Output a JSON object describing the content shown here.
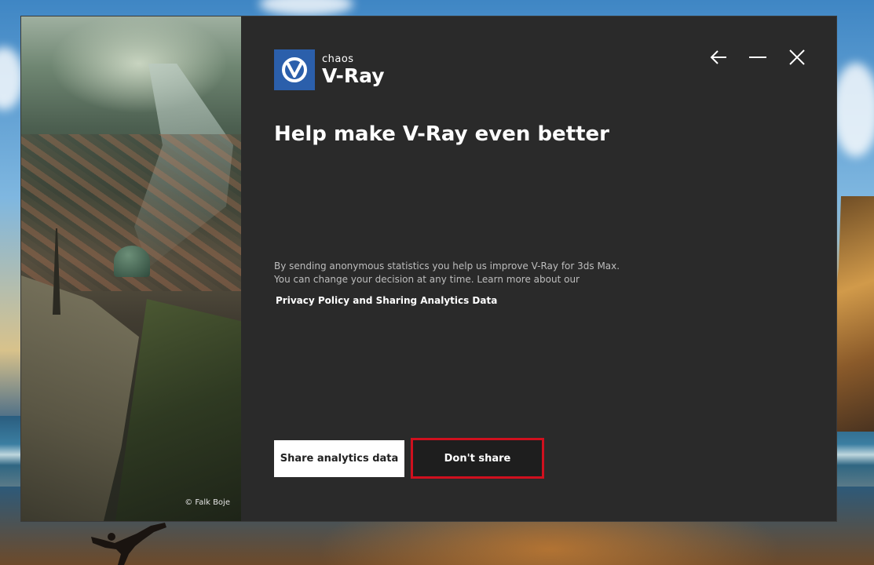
{
  "app": {
    "brand_company": "chaos",
    "brand_product": "V-Ray",
    "accent_color": "#2b5fab",
    "highlight_color": "#d0101e"
  },
  "window_controls": {
    "back_icon": "arrow-left-icon",
    "minimize_icon": "minimize-icon",
    "close_icon": "close-icon"
  },
  "content": {
    "title": "Help make V-Ray even better",
    "description_line1": "By sending anonymous statistics you help us improve V-Ray for 3ds Max.",
    "description_line2": "You can change your decision at any time. Learn more about our",
    "privacy_link": "Privacy Policy and Sharing Analytics Data"
  },
  "buttons": {
    "share_label": "Share analytics data",
    "dont_share_label": "Don't share"
  },
  "photo": {
    "credit": "© Falk Boje"
  }
}
